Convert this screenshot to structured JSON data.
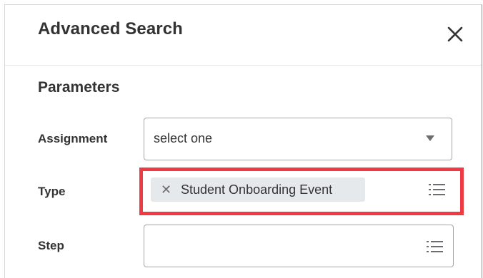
{
  "dialog": {
    "title": "Advanced Search",
    "close_label": "Close"
  },
  "parameters": {
    "heading": "Parameters",
    "assignment": {
      "label": "Assignment",
      "value": "select one"
    },
    "type": {
      "label": "Type",
      "selected_items": [
        "Student Onboarding Event"
      ]
    },
    "step": {
      "label": "Step",
      "value": ""
    }
  },
  "icons": {
    "close": "close-icon",
    "dropdown": "chevron-down-icon",
    "list": "list-icon",
    "remove": "remove-icon"
  },
  "colors": {
    "highlight": "#ee3a43",
    "pill_background": "#e6e9ec",
    "text": "#333333"
  }
}
